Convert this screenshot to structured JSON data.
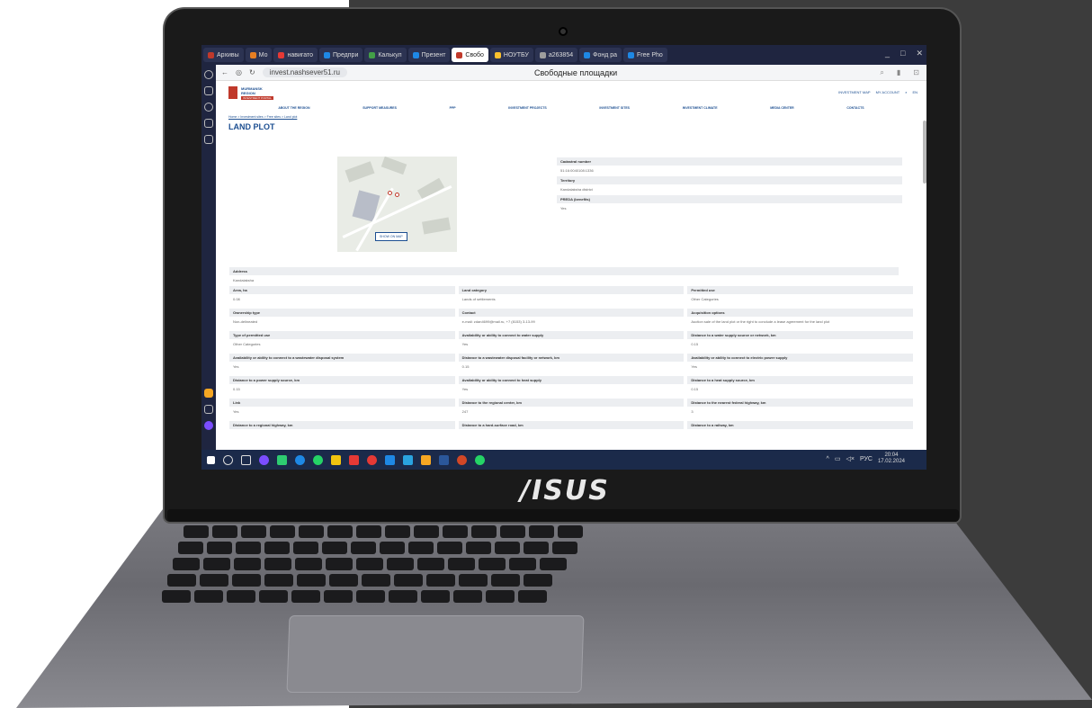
{
  "browser": {
    "tabs": [
      {
        "label": "Архивы",
        "color": "#c0392b"
      },
      {
        "label": "Мо",
        "color": "#e67e22"
      },
      {
        "label": "навигато",
        "color": "#e53935"
      },
      {
        "label": "Предпри",
        "color": "#1e88e5"
      },
      {
        "label": "Калькул",
        "color": "#43a047"
      },
      {
        "label": "Презент",
        "color": "#1e88e5"
      },
      {
        "label": "Свобо",
        "color": "#c0392b",
        "active": true
      },
      {
        "label": "НОУТБУ",
        "color": "#fbc02d"
      },
      {
        "label": "a263854",
        "color": "#9e9e9e"
      },
      {
        "label": "Фонд ра",
        "color": "#1e88e5"
      },
      {
        "label": "Free Pho",
        "color": "#1e88e5"
      }
    ],
    "url": "invest.nashsever51.ru",
    "page_title": "Свободные площадки"
  },
  "site": {
    "logo_line1": "MURMANSK",
    "logo_line2": "REGION",
    "logo_tag": "INVESTMENT PORTAL",
    "investment_map": "INVESTMENT MAP",
    "account": "MY ACCOUNT",
    "lang": "EN",
    "nav": [
      "ABOUT THE REGION",
      "SUPPORT MEASURES",
      "PPP",
      "INVESTMENT PROJECTS",
      "INVESTMENT SITES",
      "INVESTMENT CLIMATE",
      "MEDIA CENTER",
      "CONTACTS"
    ],
    "breadcrumb": "Home > Investment sites > Free sites > Land plot",
    "heading": "LAND PLOT",
    "map_button": "SHOW ON MAP",
    "cadastral_label": "Cadastral number",
    "cadastral_value": "51:16:0040108:1336",
    "territory_label": "Territory",
    "territory_value": "Kandalaksha district",
    "preda_label": "PREDA (benefits)",
    "preda_value": "Yes",
    "address_label": "Address",
    "address_value": "Kandalaksha",
    "fields": [
      {
        "label": "Area, ha",
        "value": "0.08"
      },
      {
        "label": "Land category",
        "value": "Lands of settlements"
      },
      {
        "label": "Permitted use",
        "value": "Other Categories"
      },
      {
        "label": "Ownership type",
        "value": "Non-delineated"
      },
      {
        "label": "Contact",
        "value": "e-mail: zdan4699@mail.ru, +7 (8153) 3-13-99"
      },
      {
        "label": "Acquisition options",
        "value": "Auction sale of the land plot or the right to conclude a lease agreement for the land plot"
      },
      {
        "label": "Type of permitted use",
        "value": "Other Categories"
      },
      {
        "label": "Availability or ability to connect to water supply",
        "value": "Yes"
      },
      {
        "label": "Distance to a water supply source or network, km",
        "value": "0.15"
      },
      {
        "label": "Availability or ability to connect to a wastewater disposal system",
        "value": "Yes"
      },
      {
        "label": "Distance to a wastewater disposal facility or network, km",
        "value": "0.15"
      },
      {
        "label": "Availability or ability to connect to electric power supply",
        "value": "Yes"
      },
      {
        "label": "Distance to a power supply source, km",
        "value": "0.15"
      },
      {
        "label": "Availability or ability to connect to heat supply",
        "value": "Yes"
      },
      {
        "label": "Distance to a heat supply source, km",
        "value": "0.15"
      },
      {
        "label": "Link",
        "value": "Yes"
      },
      {
        "label": "Distance to the regional center, km",
        "value": "247"
      },
      {
        "label": "Distance to the nearest federal highway, km",
        "value": "3"
      },
      {
        "label": "Distance to a regional highway, km",
        "value": ""
      },
      {
        "label": "Distance to a hard-surface road, km",
        "value": ""
      },
      {
        "label": "Distance to a railway, km",
        "value": ""
      }
    ]
  },
  "taskbar": {
    "lang": "РУС",
    "time": "20:04",
    "date": "17.02.2024"
  },
  "laptop": {
    "brand": "/ISUS"
  }
}
